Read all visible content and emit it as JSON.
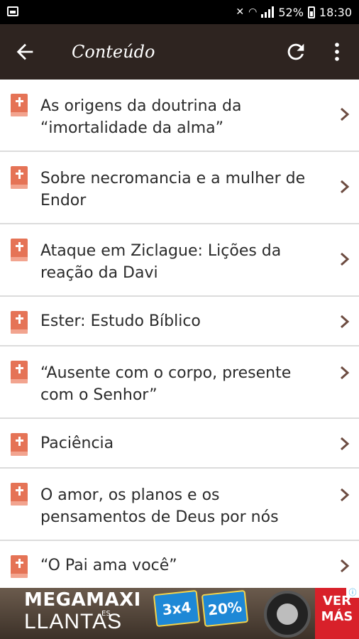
{
  "status_bar": {
    "battery": "52%",
    "time": "18:30"
  },
  "app_bar": {
    "title": "Conteúdo"
  },
  "items": [
    {
      "label": "As origens da doutrina da “imortalidade da alma”"
    },
    {
      "label": "Sobre necromancia e a mulher de Endor"
    },
    {
      "label": "Ataque em Ziclague: Lições da reação da Davi"
    },
    {
      "label": "Ester: Estudo Bíblico"
    },
    {
      "label": "“Ausente com o corpo, presente com o Senhor”"
    },
    {
      "label": "Paciência"
    },
    {
      "label": "O amor, os planos e os pensamentos de Deus por nós"
    },
    {
      "label": "“O Pai ama você”"
    }
  ],
  "ad": {
    "brand_line1": "MEGAMAXI",
    "brand_line2": "LLANTAS",
    "brand_es": "ES",
    "promo1": "3x4",
    "promo2": "20%",
    "cta": "VER MÁS"
  },
  "colors": {
    "app_bar": "#2e2420",
    "accent_book": "#e57356",
    "chevron": "#6d4c41"
  }
}
